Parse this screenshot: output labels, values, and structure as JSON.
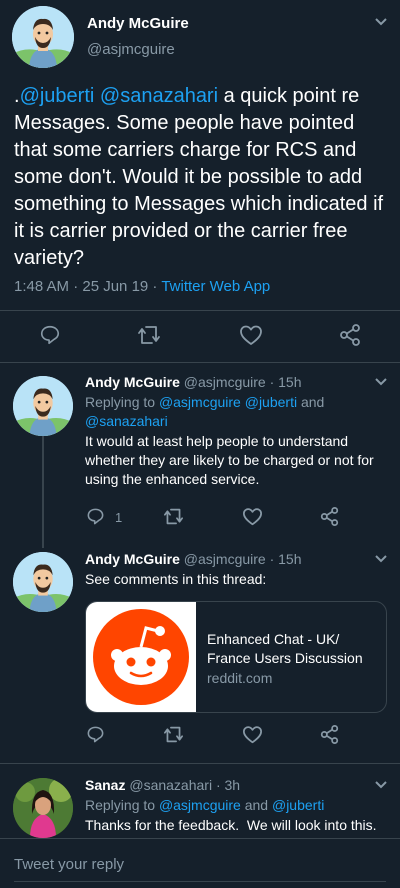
{
  "main_tweet": {
    "name": "Andy McGuire",
    "handle": "@asjmcguire",
    "text_prefix": ".",
    "mentions": "@juberti @sanazahari",
    "text_body": " a quick point re Messages. Some people have pointed that some carriers charge for RCS and some don't. Would it be possible to add something to Messages which indicated if it is carrier provided or the carrier free variety?",
    "timestamp": "1:48 AM · 25 Jun 19 · ",
    "source": "Twitter Web App"
  },
  "replies": [
    {
      "name": "Andy McGuire",
      "handle_time": "@asjmcguire · 15h",
      "replying_prefix": "Replying to ",
      "replying_to_1": "@asjmcguire @juberti",
      "replying_and": " and ",
      "replying_to_2": "@sanazahari",
      "text": "It would at least help people to understand whether they are likely to be charged or not for using the enhanced service.",
      "reply_count": "1"
    },
    {
      "name": "Andy McGuire",
      "handle_time": "@asjmcguire · 15h",
      "text": "See comments in this thread:",
      "card": {
        "title": "Enhanced Chat - UK/ France Users Discussion",
        "domain": "reddit.com"
      }
    },
    {
      "name": "Sanaz",
      "handle_time": "@sanazahari · 3h",
      "replying_prefix": "Replying to ",
      "replying_to_1": "@asjmcguire",
      "replying_and": " and ",
      "replying_to_2": "@juberti",
      "text": "Thanks for the feedback.  We will look into this."
    }
  ],
  "composer": {
    "placeholder": "Tweet your reply"
  },
  "colors": {
    "background": "#15202b",
    "accent": "#1da1f2",
    "secondary_text": "#8899a6",
    "divider": "#38444d",
    "reddit": "#ff4500"
  },
  "icons": [
    "chevron-down-icon",
    "reply-icon",
    "retweet-icon",
    "like-icon",
    "share-icon",
    "reddit-logo"
  ]
}
